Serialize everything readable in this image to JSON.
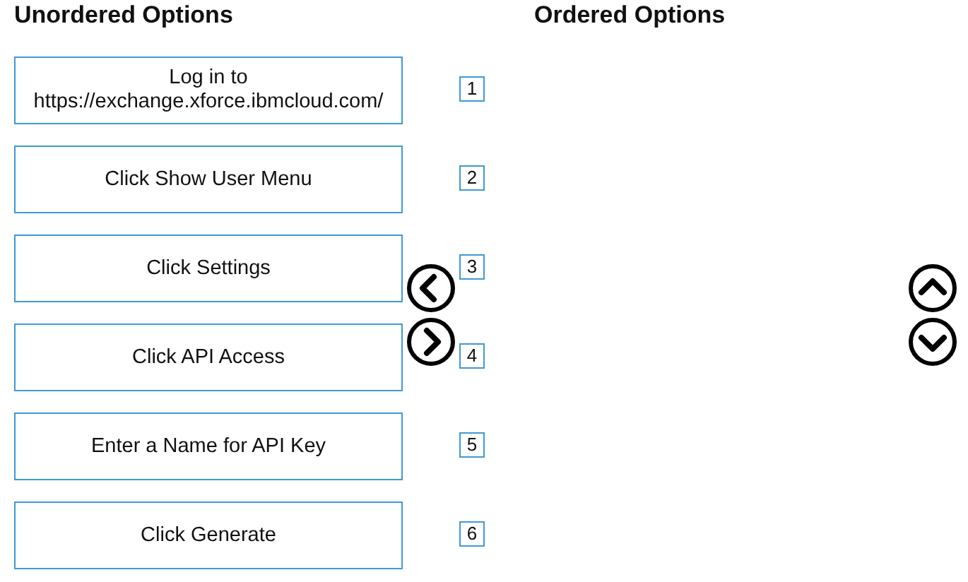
{
  "unordered": {
    "title": "Unordered Options",
    "options": [
      {
        "text": "Log in to\nhttps://exchange.xforce.ibmcloud.com/"
      },
      {
        "text": "Click Show User Menu"
      },
      {
        "text": "Click Settings"
      },
      {
        "text": "Click API Access"
      },
      {
        "text": "Enter a Name for API Key"
      },
      {
        "text": "Click Generate"
      }
    ],
    "numbers": [
      "1",
      "2",
      "3",
      "4",
      "5",
      "6"
    ]
  },
  "ordered": {
    "title": "Ordered Options"
  }
}
